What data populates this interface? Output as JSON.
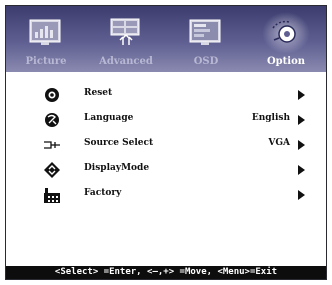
{
  "tabs": [
    {
      "label": "Picture",
      "icon": "picture-icon",
      "active": false
    },
    {
      "label": "Advanced",
      "icon": "advanced-icon",
      "active": false
    },
    {
      "label": "OSD",
      "icon": "osd-icon",
      "active": false
    },
    {
      "label": "Option",
      "icon": "option-icon",
      "active": true
    }
  ],
  "menu": [
    {
      "label": "Reset",
      "icon": "reset-icon",
      "value": ""
    },
    {
      "label": "Language",
      "icon": "language-icon",
      "value": "English"
    },
    {
      "label": "Source Select",
      "icon": "source-select-icon",
      "value": "VGA"
    },
    {
      "label": "DisplayMode",
      "icon": "display-mode-icon",
      "value": ""
    },
    {
      "label": "Factory",
      "icon": "factory-icon",
      "value": ""
    }
  ],
  "footer": {
    "hint": "<Select> =Enter, <–,+> =Move, <Menu>=Exit"
  },
  "colors": {
    "tab_bar": "#5f5f92",
    "active_label": "#ffffff",
    "inactive_label": "#b8b8d4",
    "footer_bg": "#0d0d0d"
  }
}
